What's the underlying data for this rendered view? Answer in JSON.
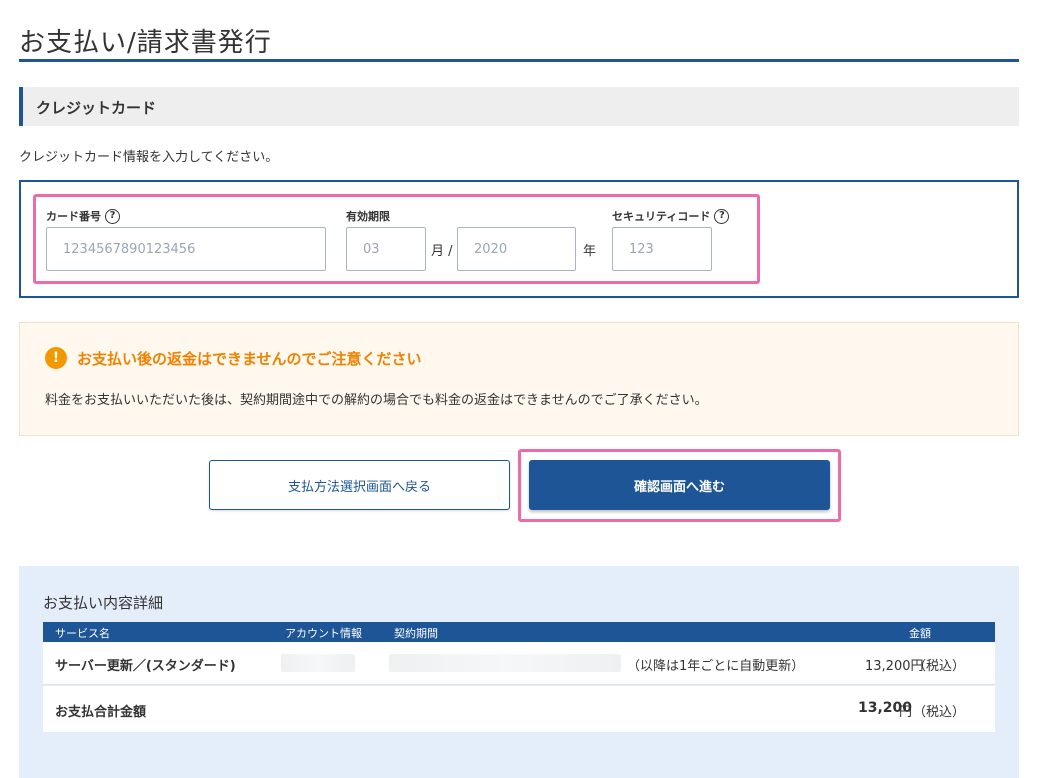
{
  "page": {
    "title": "お支払い/請求書発行"
  },
  "section": {
    "title": "クレジットカード",
    "intro": "クレジットカード情報を入力してください。"
  },
  "card_form": {
    "number": {
      "label": "カード番号",
      "placeholder": "1234567890123456",
      "help_icon": "question-circle-icon"
    },
    "expiry": {
      "label": "有効期限",
      "month_placeholder": "03",
      "month_unit": "月 /",
      "year_placeholder": "2020",
      "year_unit": "年"
    },
    "security": {
      "label": "セキュリティコード",
      "placeholder": "123",
      "help_icon": "question-circle-icon"
    }
  },
  "notice": {
    "icon": "exclamation-circle-icon",
    "title": "お支払い後の返金はできませんのでご注意ください",
    "body": "料金をお支払いいただいた後は、契約期間途中での解約の場合でも料金の返金はできませんのでご了承ください。"
  },
  "buttons": {
    "back": "支払方法選択画面へ戻る",
    "next": "確認画面へ進む"
  },
  "details": {
    "title": "お支払い内容詳細",
    "columns": {
      "service": "サービス名",
      "account": "アカウント情報",
      "period": "契約期間",
      "amount": "金額"
    },
    "item": {
      "service": "サーバー更新／(スタンダード)",
      "renewal_note": "（以降は1年ごとに自動更新）",
      "amount": "13,200円",
      "tax": "（税込）"
    },
    "total": {
      "label": "お支払合計金額",
      "amount": "13,200",
      "unit": "円",
      "tax": "（税込）"
    }
  },
  "colors": {
    "primary": "#1d5596",
    "highlight": "#ef6aa8",
    "warning": "#f08200",
    "notice_bg": "#fff8ef",
    "details_bg": "#e4eefa"
  }
}
